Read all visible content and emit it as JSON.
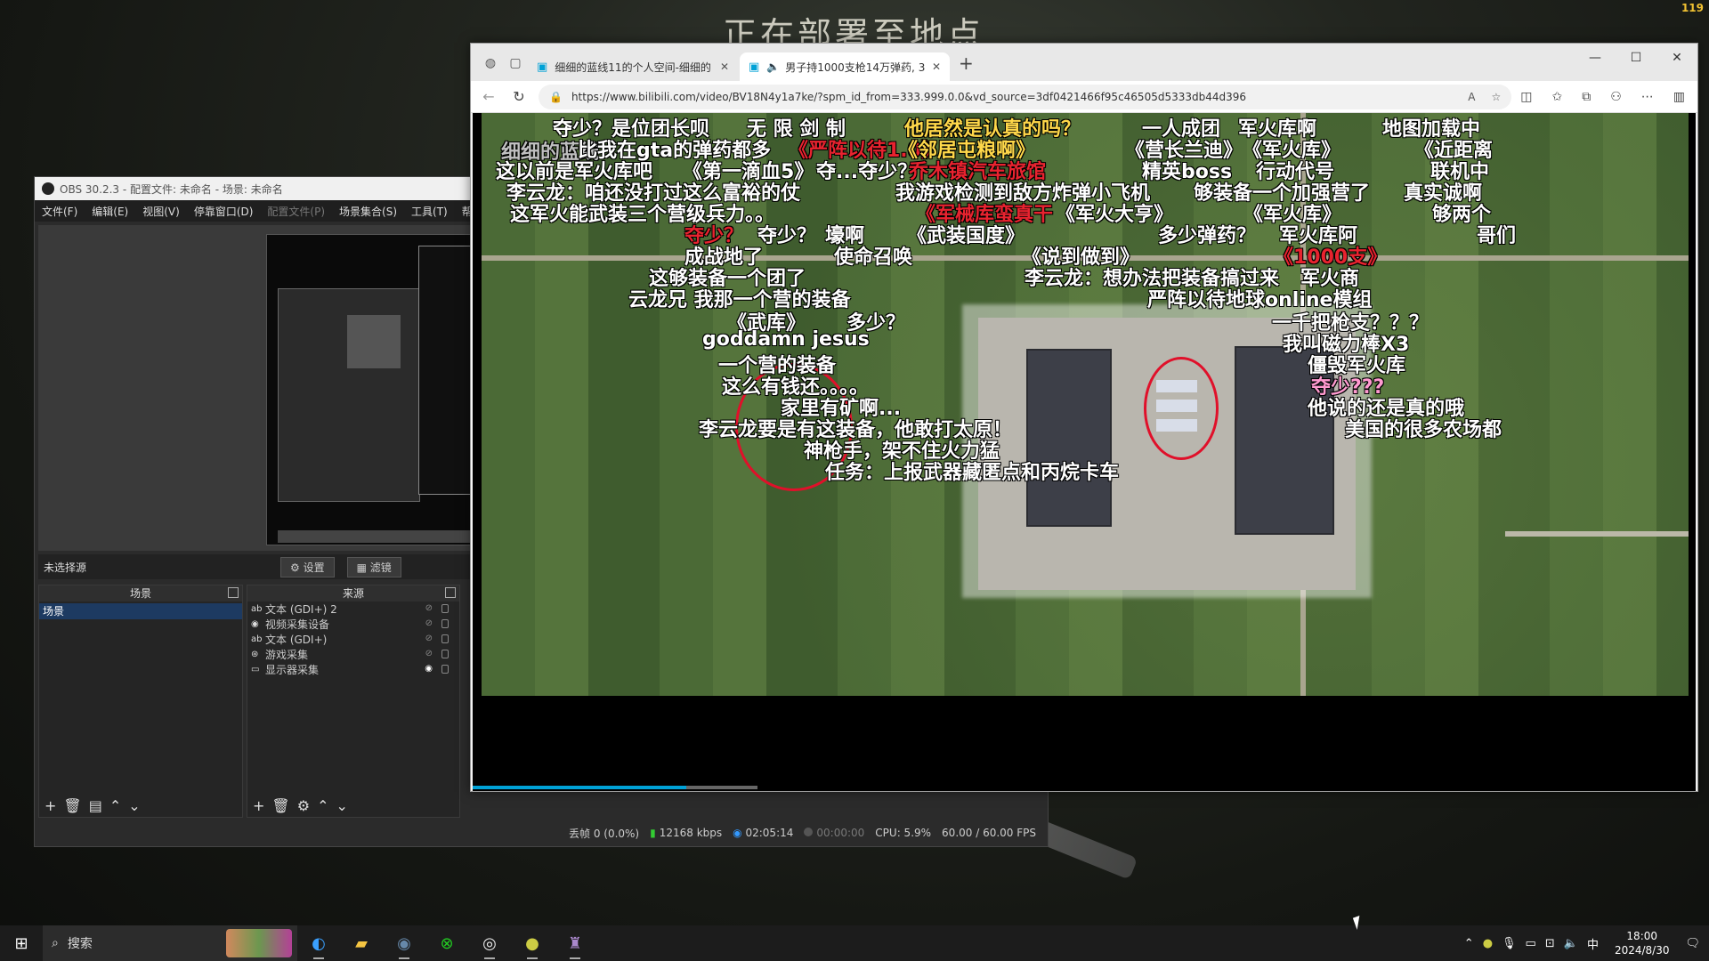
{
  "desktop": {
    "title_text": "正在部署至地点",
    "corner_tag": "119"
  },
  "obs": {
    "title": "OBS 30.2.3 - 配置文件: 未命名 - 场景: 未命名",
    "menu": [
      "文件(F)",
      "编辑(E)",
      "视图(V)",
      "停靠窗口(D)",
      "配置文件(P)",
      "场景集合(S)",
      "工具(T)",
      "帮助"
    ],
    "no_source_label": "未选择源",
    "settings_btn": "设置",
    "filters_btn": "滤镜",
    "scenes_header": "场景",
    "sources_header": "来源",
    "scenes": [
      "场景"
    ],
    "sources": [
      {
        "icon": "text-icon",
        "label": "文本 (GDI+) 2"
      },
      {
        "icon": "camera-icon",
        "label": "视频采集设备"
      },
      {
        "icon": "text-icon",
        "label": "文本 (GDI+)"
      },
      {
        "icon": "gamepad-icon",
        "label": "游戏采集"
      },
      {
        "icon": "monitor-icon",
        "label": "显示器采集"
      }
    ],
    "status": {
      "dropped": "丢帧 0 (0.0%)",
      "bitrate": "12168 kbps",
      "live_time": "02:05:14",
      "rec_time": "00:00:00",
      "cpu": "CPU: 5.9%",
      "fps": "60.00 / 60.00 FPS"
    }
  },
  "browser": {
    "tabs": [
      {
        "title": "细细的蓝线11的个人空间-细细的",
        "active": false
      },
      {
        "title": "男子持1000支枪14万弹药, 3",
        "active": true
      }
    ],
    "url": "https://www.bilibili.com/video/BV18N4y1a7ke/?spm_id_from=333.999.0.0&vd_source=3df0421466f95c46505d5333db44d396",
    "video_progress_fraction": 0.175
  },
  "danmaku": [
    {
      "text": "夺少？是位团长呗",
      "style": "w"
    },
    {
      "text": "无 限 剑 制",
      "style": "w"
    },
    {
      "text": "他居然是认真的吗？",
      "style": "y"
    },
    {
      "text": "一人成团",
      "style": "w"
    },
    {
      "text": "军火库啊",
      "style": "w"
    },
    {
      "text": "地图加载中",
      "style": "w"
    },
    {
      "text": "细细的蓝线",
      "style": "w2"
    },
    {
      "text": "比我在gta的弹药都多",
      "style": "w"
    },
    {
      "text": "《严阵以待1.0》",
      "style": "r"
    },
    {
      "text": "《邻居屯粮啊》",
      "style": "y"
    },
    {
      "text": "《营长兰迪》",
      "style": "w"
    },
    {
      "text": "《军火库》",
      "style": "w"
    },
    {
      "text": "《近距离",
      "style": "w"
    },
    {
      "text": "这以前是军火库吧",
      "style": "w"
    },
    {
      "text": "《第一滴血5》",
      "style": "w"
    },
    {
      "text": "夺...夺少？",
      "style": "w"
    },
    {
      "text": "乔木镇汽车旅馆",
      "style": "r"
    },
    {
      "text": "精英boss",
      "style": "w"
    },
    {
      "text": "行动代号",
      "style": "w"
    },
    {
      "text": "联机中",
      "style": "w"
    },
    {
      "text": "李云龙：咱还没打过这么富裕的仗",
      "style": "w"
    },
    {
      "text": "我游戏检测到敌方炸弹小飞机",
      "style": "w"
    },
    {
      "text": "够装备一个加强营了",
      "style": "w"
    },
    {
      "text": "真实诚啊",
      "style": "w"
    },
    {
      "text": "这军火能武装三个营级兵力。。",
      "style": "w"
    },
    {
      "text": "《军械库蛮真干",
      "style": "r"
    },
    {
      "text": "《军火大亨》",
      "style": "w"
    },
    {
      "text": "《军火库》",
      "style": "w"
    },
    {
      "text": "够两个",
      "style": "w"
    },
    {
      "text": "夺少？",
      "style": "r"
    },
    {
      "text": "夺少？",
      "style": "w"
    },
    {
      "text": "壕啊",
      "style": "w"
    },
    {
      "text": "《武装国度》",
      "style": "w"
    },
    {
      "text": "多少弹药？",
      "style": "w"
    },
    {
      "text": "军火库阿",
      "style": "w"
    },
    {
      "text": "哥们",
      "style": "w"
    },
    {
      "text": "成战地了",
      "style": "w"
    },
    {
      "text": "使命召唤",
      "style": "w"
    },
    {
      "text": "《说到做到》",
      "style": "w"
    },
    {
      "text": "《1000支》",
      "style": "r"
    },
    {
      "text": "这够装备一个团了",
      "style": "w"
    },
    {
      "text": "李云龙：想办法把装备搞过来",
      "style": "w"
    },
    {
      "text": "军火商",
      "style": "w"
    },
    {
      "text": "云龙兄 我那一个营的装备",
      "style": "w"
    },
    {
      "text": "严阵以待地球online模组",
      "style": "w"
    },
    {
      "text": "《武库》",
      "style": "w"
    },
    {
      "text": "多少？",
      "style": "w"
    },
    {
      "text": "一千把枪支？？？",
      "style": "w"
    },
    {
      "text": "goddamn jesus",
      "style": "w"
    },
    {
      "text": "我叫磁力棒X3",
      "style": "w"
    },
    {
      "text": "一个营的装备",
      "style": "w"
    },
    {
      "text": "僵毁军火库",
      "style": "w"
    },
    {
      "text": "这么有钱还。。。。",
      "style": "w"
    },
    {
      "text": "夺少???",
      "style": "p"
    },
    {
      "text": "家里有矿啊...",
      "style": "w"
    },
    {
      "text": "他说的还是真的哦",
      "style": "w"
    },
    {
      "text": "李云龙要是有这装备，他敢打太原！",
      "style": "w"
    },
    {
      "text": "美国的很多农场都",
      "style": "w"
    },
    {
      "text": "神枪手，架不住火力猛",
      "style": "w"
    },
    {
      "text": "任务：上报武器藏匿点和丙烷卡车",
      "style": "w"
    }
  ],
  "taskbar": {
    "search_label": "搜索",
    "apps": [
      "edge-icon",
      "folder-icon",
      "steam-icon",
      "xbox-icon",
      "obs-icon",
      "app-icon",
      "game-icon"
    ],
    "ime": "中",
    "time": "18:00",
    "date": "2024/8/30"
  }
}
